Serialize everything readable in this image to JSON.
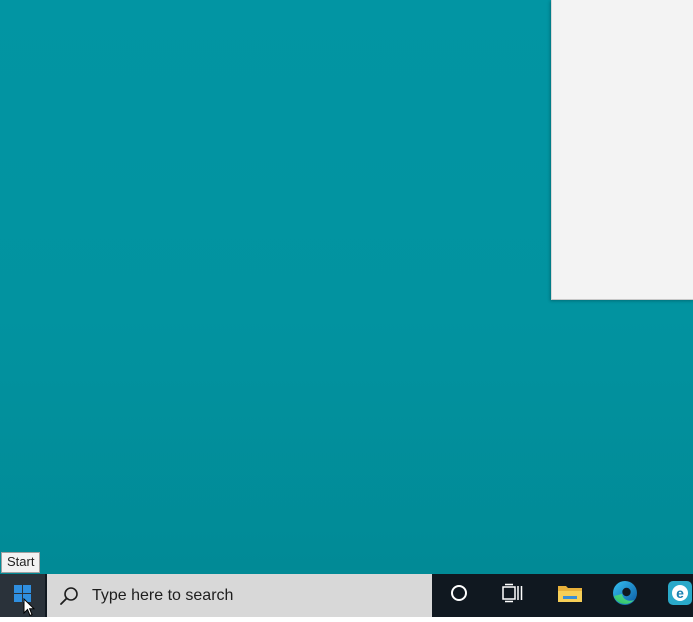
{
  "desktop": {
    "background_color": "#0295a3"
  },
  "tooltip": {
    "text": "Start"
  },
  "taskbar": {
    "start_icon": "windows-logo-icon",
    "search": {
      "placeholder": "Type here to search",
      "icon": "search-icon"
    },
    "icons": [
      "cortana-icon",
      "task-view-icon",
      "file-explorer-icon",
      "edge-icon",
      "internet-explorer-icon"
    ]
  },
  "colors": {
    "taskbar_bg": "#101820",
    "accent_blue": "#0078d7"
  }
}
